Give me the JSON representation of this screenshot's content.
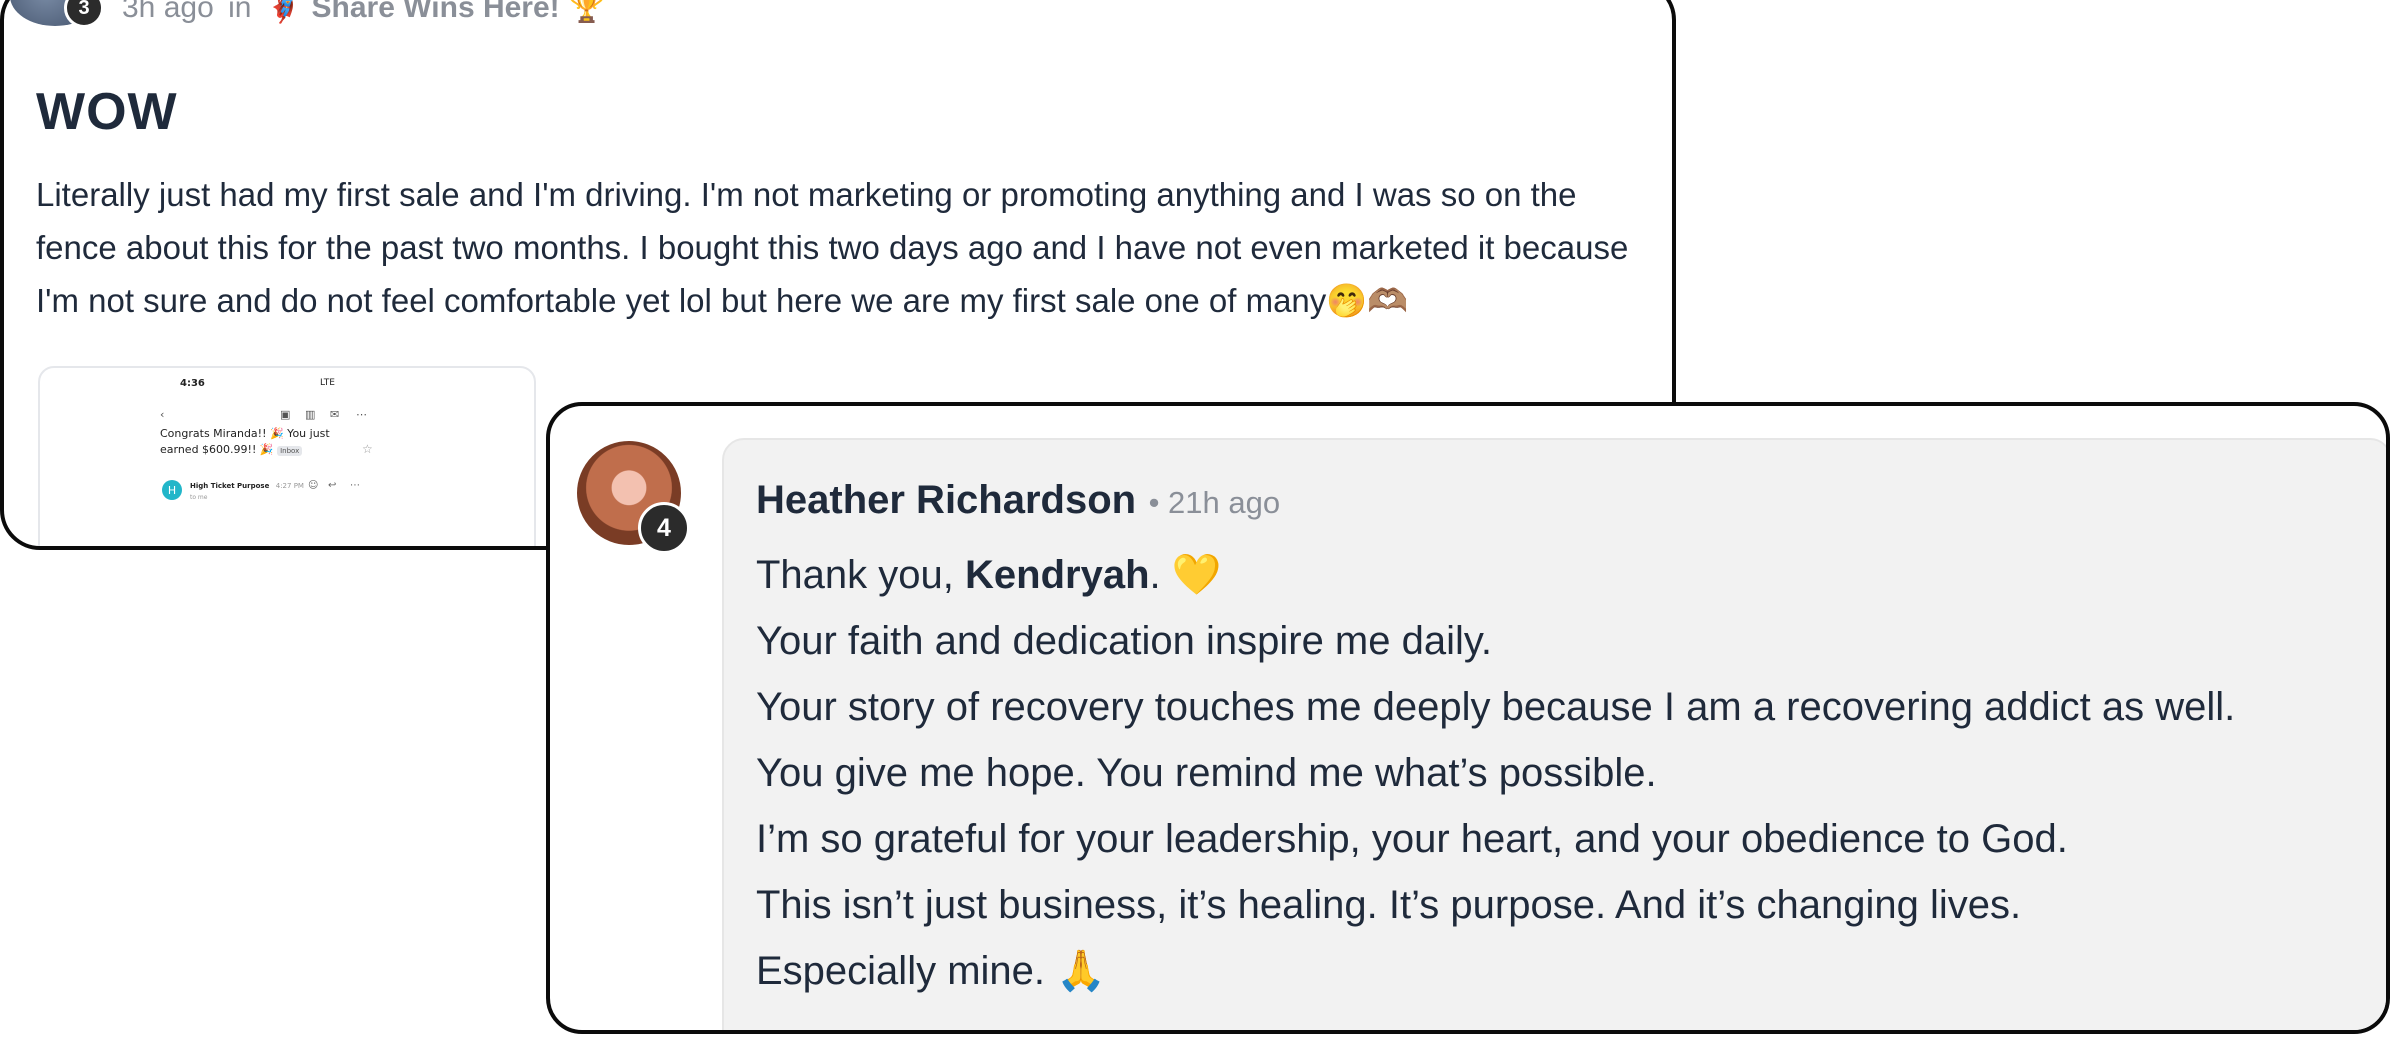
{
  "post": {
    "author_badge": "3",
    "time_ago": "3h ago",
    "in_word": "in",
    "group_icon": "🦸‍♀️",
    "group_name": "Share Wins Here!",
    "group_trophy": "🏆",
    "title": "WOW",
    "body": "Literally just had my first sale and I'm driving. I'm not marketing or promoting anything and I was so on the fence about this for the past two months. I bought this two days ago and I have not even marketed it because I'm not sure and do not feel comfortable yet lol but here we are my first sale one of many🤭🫶🏽",
    "attachment": {
      "time": "4:36",
      "signal": "LTE",
      "back_icon": "‹",
      "subject": "Congrats Miranda!! 🎉 You just earned $600.99!! 🎉",
      "inbox_label": "Inbox",
      "sender_initial": "H",
      "sender": "High Ticket Purpose",
      "sender_time": "4:27 PM",
      "to": "to me"
    }
  },
  "comment": {
    "badge": "4",
    "author": "Heather Richardson",
    "time_ago": "• 21h ago",
    "line1_prefix": "Thank you, ",
    "line1_name": "Kendryah",
    "line1_suffix": ". 💛",
    "lines": [
      "Your faith and dedication inspire me daily.",
      "Your story of recovery touches me deeply because I am a recovering addict as well.",
      "You give me hope. You remind me what’s possible.",
      "I’m so grateful for your leadership, your heart, and your obedience to God.",
      "This isn’t just business, it’s healing. It’s purpose. And it’s changing lives.",
      "Especially mine. 🙏"
    ]
  }
}
